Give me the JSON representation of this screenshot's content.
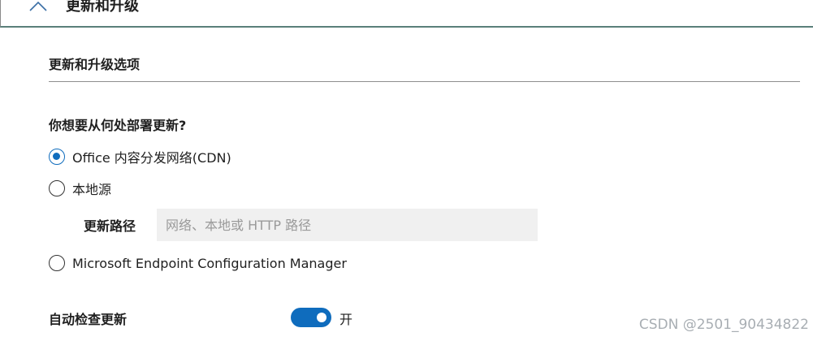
{
  "section": {
    "title": "更新和升级",
    "expanded": true
  },
  "subsection": {
    "title": "更新和升级选项"
  },
  "update_source": {
    "question": "你想要从何处部署更新?",
    "options": [
      {
        "label": "Office 内容分发网络(CDN)",
        "selected": true
      },
      {
        "label": "本地源",
        "selected": false
      },
      {
        "label": "Microsoft Endpoint Configuration Manager",
        "selected": false
      }
    ],
    "path_label": "更新路径",
    "path_value": "",
    "path_placeholder": "网络、本地或 HTTP 路径"
  },
  "auto_check": {
    "label": "自动检查更新",
    "state_text": "开",
    "on": true
  },
  "watermark": "CSDN @2501_90434822",
  "colors": {
    "accent": "#0f6cbd",
    "input_bg": "#f0f0f0",
    "divider": "#8f8f8f"
  }
}
